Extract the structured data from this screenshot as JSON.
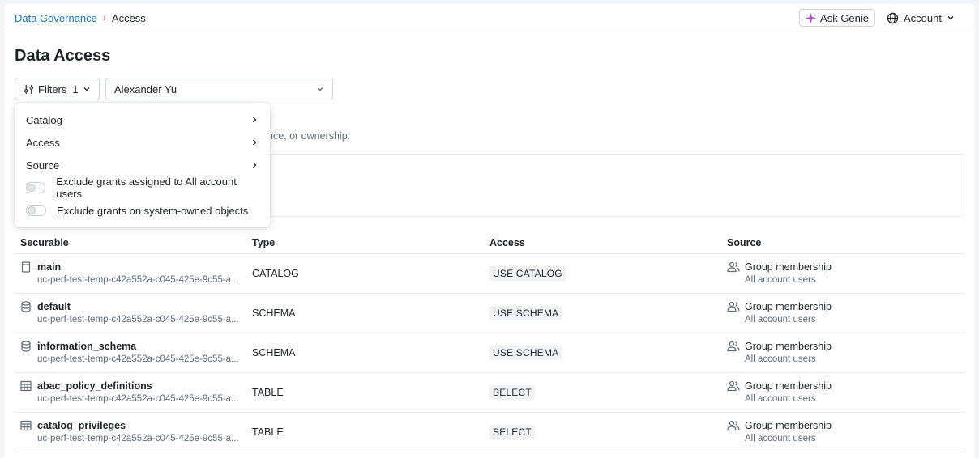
{
  "breadcrumb": {
    "parent": "Data Governance",
    "separator": "›",
    "current": "Access"
  },
  "header": {
    "genie_label": "Ask Genie",
    "account_label": "Account"
  },
  "page": {
    "title": "Data Access"
  },
  "filters": {
    "label": "Filters",
    "count": "1"
  },
  "principal": {
    "value": "Alexander Yu"
  },
  "description_fragment": "nce, or ownership.",
  "menu": {
    "items": [
      {
        "label": "Catalog"
      },
      {
        "label": "Access"
      },
      {
        "label": "Source"
      }
    ],
    "toggles": [
      {
        "label": "Exclude grants assigned to All account users",
        "on": false
      },
      {
        "label": "Exclude grants on system-owned objects",
        "on": false
      }
    ]
  },
  "table": {
    "headers": [
      "Securable",
      "Type",
      "Access",
      "Source"
    ],
    "rows": [
      {
        "icon": "catalog-icon",
        "name": "main",
        "path": "uc-perf-test-temp-c42a552a-c045-425e-9c55-a...",
        "type": "CATALOG",
        "access": "USE CATALOG",
        "source": "Group membership",
        "source_sub": "All account users"
      },
      {
        "icon": "schema-icon",
        "name": "default",
        "path": "uc-perf-test-temp-c42a552a-c045-425e-9c55-a...",
        "type": "SCHEMA",
        "access": "USE SCHEMA",
        "source": "Group membership",
        "source_sub": "All account users"
      },
      {
        "icon": "schema-icon",
        "name": "information_schema",
        "path": "uc-perf-test-temp-c42a552a-c045-425e-9c55-a...",
        "type": "SCHEMA",
        "access": "USE SCHEMA",
        "source": "Group membership",
        "source_sub": "All account users"
      },
      {
        "icon": "table-icon",
        "name": "abac_policy_definitions",
        "path": "uc-perf-test-temp-c42a552a-c045-425e-9c55-a...",
        "type": "TABLE",
        "access": "SELECT",
        "source": "Group membership",
        "source_sub": "All account users"
      },
      {
        "icon": "table-icon",
        "name": "catalog_privileges",
        "path": "uc-perf-test-temp-c42a552a-c045-425e-9c55-a...",
        "type": "TABLE",
        "access": "SELECT",
        "source": "Group membership",
        "source_sub": "All account users"
      }
    ]
  },
  "colors": {
    "link": "#2272b4",
    "genie_accent": "#b14fd8",
    "muted": "#5f6b7a"
  }
}
